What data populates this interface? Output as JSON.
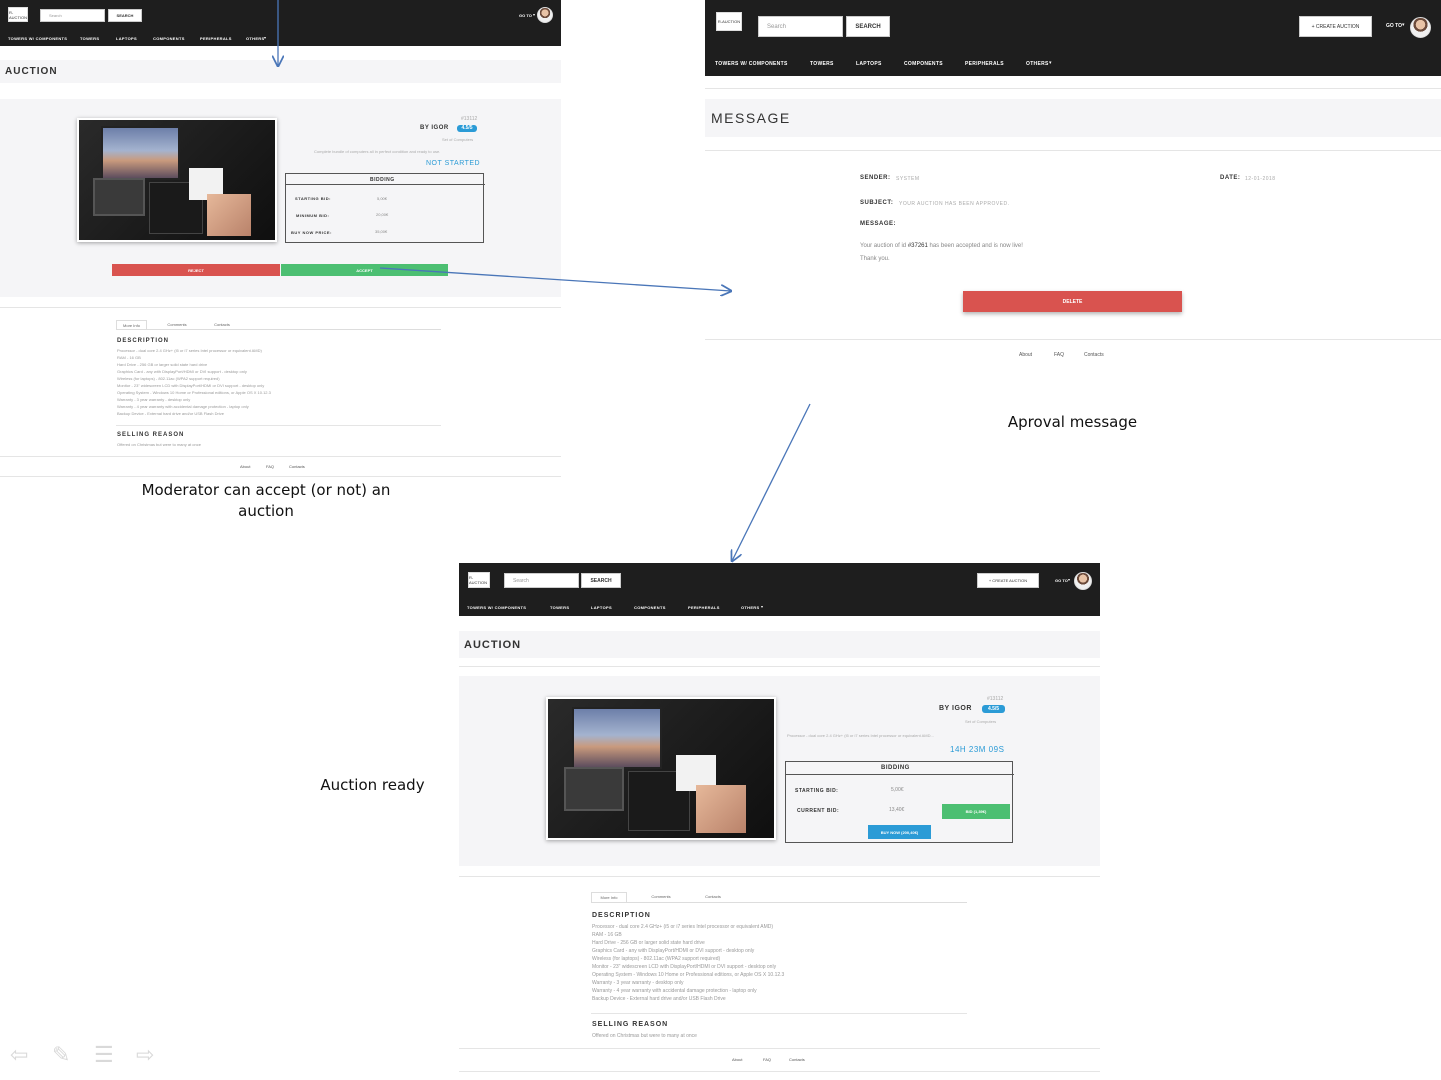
{
  "nav": {
    "search_placeholder": "Search",
    "search_button": "SEARCH",
    "create_auction": "+ CREATE AUCTION",
    "go_to": "GO TO",
    "logo_text": "R-AUCTION",
    "categories": [
      "TOWERS W/ COMPONENTS",
      "TOWERS",
      "LAPTOPS",
      "COMPONENTS",
      "PERIPHERALS",
      "OTHERS"
    ]
  },
  "moderator_view": {
    "page_title": "AUCTION",
    "auction_id": "#13112",
    "seller": "BY IGOR",
    "rating": "4.5/5",
    "product_name": "Set of Computers",
    "product_summary": "Complete bundle of computers all in perfect condition and ready to use.",
    "status": "NOT STARTED",
    "bidding": {
      "title": "BIDDING",
      "starting_bid_label": "STARTING BID:",
      "starting_bid_value": "5,00€",
      "minimum_bid_label": "MINIMUM BID:",
      "minimum_bid_value": "20,00€",
      "buy_now_label": "BUY NOW PRICE:",
      "buy_now_value": "35,00€"
    },
    "reject_button": "REJECT",
    "accept_button": "ACCEPT"
  },
  "details": {
    "tabs": [
      "More Info",
      "Comments",
      "Contacts"
    ],
    "description_title": "DESCRIPTION",
    "description_lines": [
      "Processor - dual core 2.4 GHz+ (i5 or i7 series Intel processor or equivalent AMD)",
      "RAM - 16 GB",
      "Hard Drive - 256 GB or larger solid state hard drive",
      "Graphics Card - any with DisplayPort/HDMI or DVI support - desktop only",
      "Wireless (for laptops) - 802.11ac (WPA2 support required)",
      "Monitor - 23\" widescreen LCD with DisplayPort/HDMI or DVI support - desktop only",
      "Operating System - Windows 10 Home or Professional editions, or Apple OS X 10.12.3",
      "Warranty - 3 year warranty - desktop only",
      "Warranty - 4 year warranty with accidental damage protection - laptop only",
      "Backup Device - External hard drive and/or USB Flash Drive"
    ],
    "selling_reason_title": "SELLING REASON",
    "selling_reason_text": "Offered on Christmas but were to many at once"
  },
  "footer": {
    "links": [
      "About",
      "FAQ",
      "Contacts"
    ]
  },
  "message_view": {
    "page_title": "MESSAGE",
    "sender_label": "SENDER:",
    "sender_value": "SYSTEM",
    "date_label": "DATE:",
    "date_value": "12-01-2018",
    "subject_label": "SUBJECT:",
    "subject_value": "YOUR AUCTION HAS BEEN APPROVED.",
    "message_label": "MESSAGE:",
    "body_prefix": "Your auction of id ",
    "body_id": "#37261",
    "body_suffix": " has been accepted and is now live!",
    "body_thanks": "Thank you.",
    "delete_button": "DELETE"
  },
  "ready_view": {
    "page_title": "AUCTION",
    "auction_id": "#13112",
    "seller": "BY IGOR",
    "rating": "4.5/5",
    "product_name": "Set of Computers",
    "product_summary": "Processor - dual core 2.4 GHz+ (i5 or i7 series Intel processor or equivalent AMD...",
    "countdown": "14H 23M 09S",
    "bidding": {
      "title": "BIDDING",
      "starting_bid_label": "STARTING BID:",
      "starting_bid_value": "5,00€",
      "current_bid_label": "CURRENT BID:",
      "current_bid_value": "13,40€",
      "bid_button": "BID (1,39€)",
      "buy_now_button": "BUY NOW (200,40€)"
    }
  },
  "captions": {
    "moderator": "Moderator can accept (or not) an auction",
    "approval": "Aproval message",
    "ready": "Auction ready"
  },
  "colors": {
    "navbar": "#1e1e1e",
    "reject": "#d9534f",
    "accept": "#4cbf72",
    "accent_blue": "#2b9bd6",
    "arrow": "#4a76b8"
  },
  "toolbar_icons": [
    "arrow-left-icon",
    "pen-icon",
    "menu-icon",
    "arrow-right-icon"
  ]
}
